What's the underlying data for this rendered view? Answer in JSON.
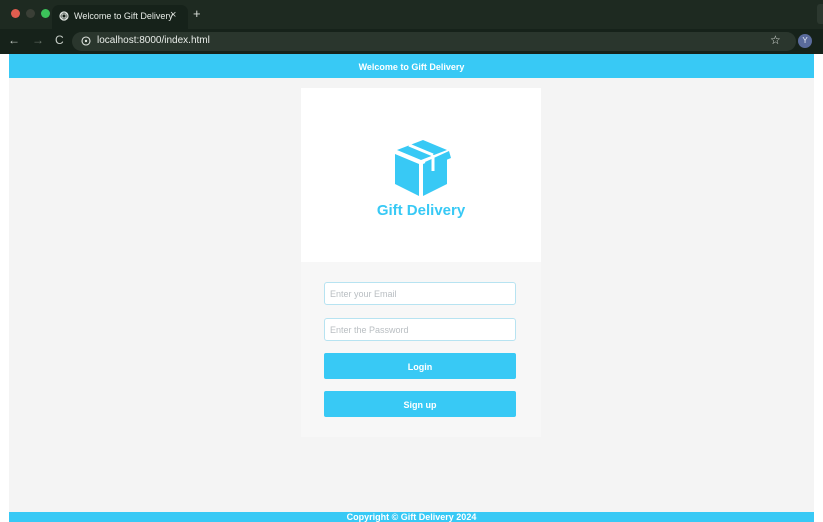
{
  "browser": {
    "tab_title": "Welcome to Gift Delivery",
    "tab_close": "×",
    "new_tab": "+",
    "url": "localhost:8000/index.html",
    "back": "←",
    "forward": "→",
    "reload": "C",
    "bookmark_star": "☆",
    "profile_initial": "Y"
  },
  "header": {
    "title": "Welcome to Gift Delivery"
  },
  "hero": {
    "brand_name": "Gift Delivery",
    "logo_icon": "box-icon"
  },
  "login_form": {
    "email_placeholder": "Enter your Email",
    "email_value": "",
    "password_placeholder": "Enter the Password",
    "password_value": "",
    "login_label": "Login",
    "signup_label": "Sign up"
  },
  "footer": {
    "copyright": "Copyright © Gift Delivery 2024"
  },
  "colors": {
    "accent": "#38c9f5",
    "page_background": "#f4f4f4",
    "browser_frame": "#1c2a20"
  }
}
